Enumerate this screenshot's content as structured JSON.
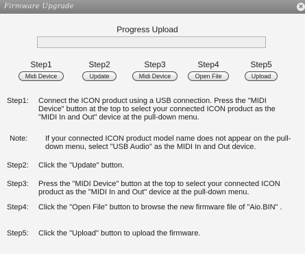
{
  "window": {
    "title": "Firmware Upgrade",
    "close_icon": "close-icon"
  },
  "progress": {
    "label": "Progress Upload",
    "value": 0
  },
  "steps": [
    {
      "title": "Step1",
      "button": "Midi Device"
    },
    {
      "title": "Step2",
      "button": "Update"
    },
    {
      "title": "Step3",
      "button": "Midi Device"
    },
    {
      "title": "Step4",
      "button": "Open File"
    },
    {
      "title": "Step5",
      "button": "Upload"
    }
  ],
  "instructions": [
    {
      "label": "Step1:",
      "text": "Connect the ICON product using a USB connection. Press the \"MIDI Device\" button at the top to select your connected ICON product as the \"MIDI In and Out\" device at the pull-down menu."
    },
    {
      "label": "Note:",
      "text": "If your connected ICON product model name does not appear on the pull-down menu, select \"USB Audio\" as the MIDI In and Out device."
    },
    {
      "label": "Step2:",
      "text": "Click the \"Update\" button."
    },
    {
      "label": "Step3:",
      "text": "Press the \"MIDI Device\" button at the top to select your connected ICON product as the \"MIDI In and Out\" device at the pull-down menu."
    },
    {
      "label": "Step4:",
      "text": "Click the \"Open File\" button to browse the new firmware file of \"Aio.BIN\" ."
    },
    {
      "label": "Step5:",
      "text": "Click the \"Upload\" button to upload the firmware."
    }
  ]
}
